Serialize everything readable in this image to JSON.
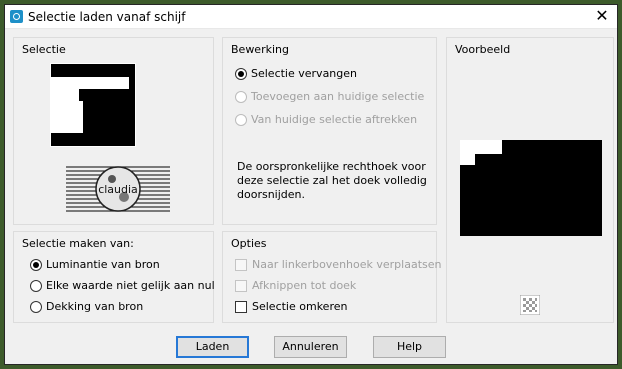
{
  "window": {
    "title": "Selectie laden vanaf schijf",
    "close_glyph": "✕"
  },
  "selectie": {
    "group_title": "Selectie",
    "logo_text": "claudia"
  },
  "bewerking": {
    "group_title": "Bewerking",
    "options": [
      {
        "label": "Selectie vervangen",
        "checked": true,
        "enabled": true
      },
      {
        "label": "Toevoegen aan huidige selectie",
        "checked": false,
        "enabled": false
      },
      {
        "label": "Van huidige selectie aftrekken",
        "checked": false,
        "enabled": false
      }
    ],
    "description": "De oorspronkelijke rechthoek voor deze selectie zal het doek volledig doorsnijden."
  },
  "voorbeeld": {
    "group_title": "Voorbeeld"
  },
  "maken_van": {
    "group_title": "Selectie maken van:",
    "options": [
      {
        "label": "Luminantie van bron",
        "checked": true
      },
      {
        "label": "Elke waarde niet gelijk aan nul",
        "checked": false
      },
      {
        "label": "Dekking van bron",
        "checked": false
      }
    ]
  },
  "opties": {
    "group_title": "Opties",
    "items": [
      {
        "label": "Naar linkerbovenhoek verplaatsen",
        "checked": false,
        "enabled": false
      },
      {
        "label": "Afknippen tot doek",
        "checked": false,
        "enabled": false
      },
      {
        "label": "Selectie omkeren",
        "checked": false,
        "enabled": true
      }
    ]
  },
  "buttons": {
    "load": "Laden",
    "cancel": "Annuleren",
    "help": "Help"
  }
}
